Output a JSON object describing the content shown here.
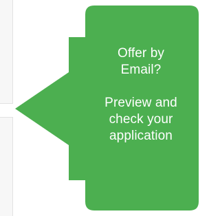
{
  "callout": {
    "color": "#4caf50",
    "lines_1": [
      "Offer by",
      "Email?"
    ],
    "lines_2": [
      "Preview and",
      "check your",
      "application"
    ]
  }
}
